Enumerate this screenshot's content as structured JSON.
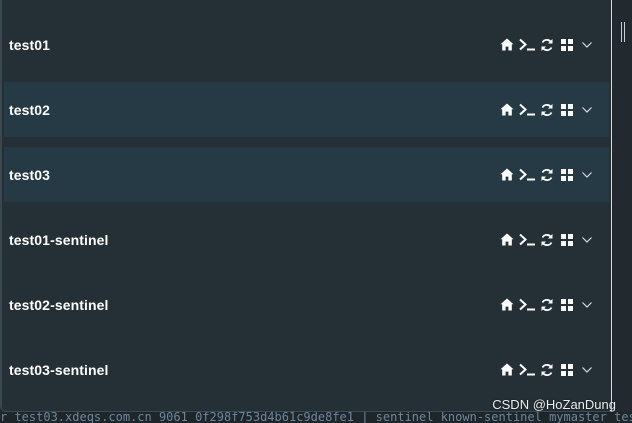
{
  "list": {
    "items": [
      {
        "label": "test01",
        "highlighted": false
      },
      {
        "label": "test02",
        "highlighted": true
      },
      {
        "label": "test03",
        "highlighted": true
      },
      {
        "label": "test01-sentinel",
        "highlighted": false
      },
      {
        "label": "test02-sentinel",
        "highlighted": false
      },
      {
        "label": "test03-sentinel",
        "highlighted": false
      }
    ],
    "actions": [
      "home-icon",
      "terminal-icon",
      "refresh-icon",
      "grid-icon",
      "chevron-down-icon"
    ]
  },
  "status_line": "r test03.xdeqs.com.cn 9061 0f298f753d4b61c9de8fe1 | sentinel known-sentinel mymaster test03.x",
  "watermark": "CSDN @HoZanDung",
  "colors": {
    "panel_bg": "#243035",
    "row_highlight": "#253a44",
    "text": "#ffffff"
  }
}
